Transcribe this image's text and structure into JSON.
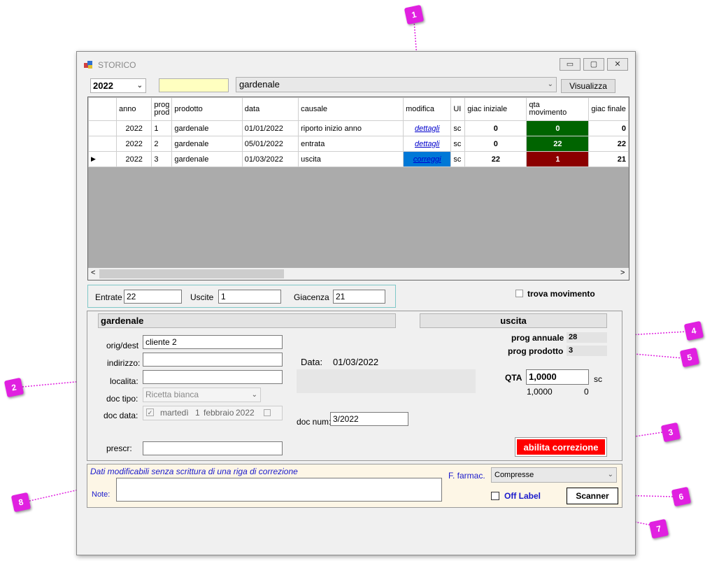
{
  "window": {
    "title": "STORICO",
    "minimize": "▭",
    "maximize": "▢",
    "close": "✕"
  },
  "toolbar": {
    "year_value": "2022",
    "product_value": "gardenale",
    "search_value": "",
    "visualizza_label": "Visualizza"
  },
  "grid": {
    "headers": [
      "anno",
      "prog\nprod",
      "prodotto",
      "data",
      "causale",
      "modifica",
      "UI",
      "giac iniziale",
      "qta\nmovimento",
      "giac finale"
    ],
    "rows": [
      {
        "indicator": "",
        "anno": "2022",
        "prog": "1",
        "prodotto": "gardenale",
        "data": "01/01/2022",
        "causale": "riporto inizio anno",
        "modifica": "dettagli",
        "um": "sc",
        "giac_iniziale": "0",
        "qta": "0",
        "giac_finale": "0"
      },
      {
        "indicator": "",
        "anno": "2022",
        "prog": "2",
        "prodotto": "gardenale",
        "data": "05/01/2022",
        "causale": "entrata",
        "modifica": "dettagli",
        "um": "sc",
        "giac_iniziale": "0",
        "qta": "22",
        "giac_finale": "22"
      },
      {
        "indicator": "▶",
        "anno": "2022",
        "prog": "3",
        "prodotto": "gardenale",
        "data": "01/03/2022",
        "causale": "uscita",
        "modifica": "correggi",
        "um": "sc",
        "giac_iniziale": "22",
        "qta": "1",
        "giac_finale": "21"
      }
    ],
    "scroll_left": "<",
    "scroll_right": ">"
  },
  "totals": {
    "entrate_label": "Entrate",
    "entrate_value": "22",
    "uscite_label": "Uscite",
    "uscite_value": "1",
    "giacenza_label": "Giacenza",
    "giacenza_value": "21"
  },
  "trova_movimento": "trova movimento",
  "detail": {
    "product_name": "gardenale",
    "movement_type": "uscita",
    "orig_dest_label": "orig/dest",
    "orig_dest_value": "cliente 2",
    "indirizzo_label": "indirizzo:",
    "indirizzo_value": "",
    "localita_label": "localita:",
    "localita_value": "",
    "doc_tipo_label": "doc tipo:",
    "doc_tipo_value": "Ricetta bianca",
    "doc_data_label": "doc data:",
    "doc_data_weekday": "martedì",
    "doc_data_day": "1",
    "doc_data_month": "febbraio",
    "doc_data_year": "2022",
    "prescr_label": "prescr:",
    "prescr_value": "",
    "data_label": "Data:",
    "data_value": "01/03/2022",
    "doc_num_label": "doc num:",
    "doc_num_value": "3/2022",
    "prog_annuale_label": "prog annuale",
    "prog_annuale_value": "28",
    "prog_prodotto_label": "prog prodotto",
    "prog_prodotto_value": "3",
    "qta_label": "QTA",
    "qta_value": "1,0000",
    "qta_unit": "sc",
    "qta_sub1": "1,0000",
    "qta_sub2": "0",
    "abilita_label": "abilita correzione"
  },
  "bottom": {
    "info_text": "Dati modificabili senza scrittura di una riga di correzione",
    "note_label": "Note:",
    "note_value": "",
    "ffarmac_label": "F. farmac.",
    "ffarmac_value": "Compresse",
    "off_label": "Off Label",
    "scanner_label": "Scanner"
  },
  "callouts": [
    "1",
    "2",
    "3",
    "4",
    "5",
    "6",
    "7",
    "8"
  ],
  "colors": {
    "callout": "#e020e0",
    "selected": "#0078d7",
    "green": "#006400",
    "red": "#8b0000",
    "abilita": "#ff0000"
  }
}
